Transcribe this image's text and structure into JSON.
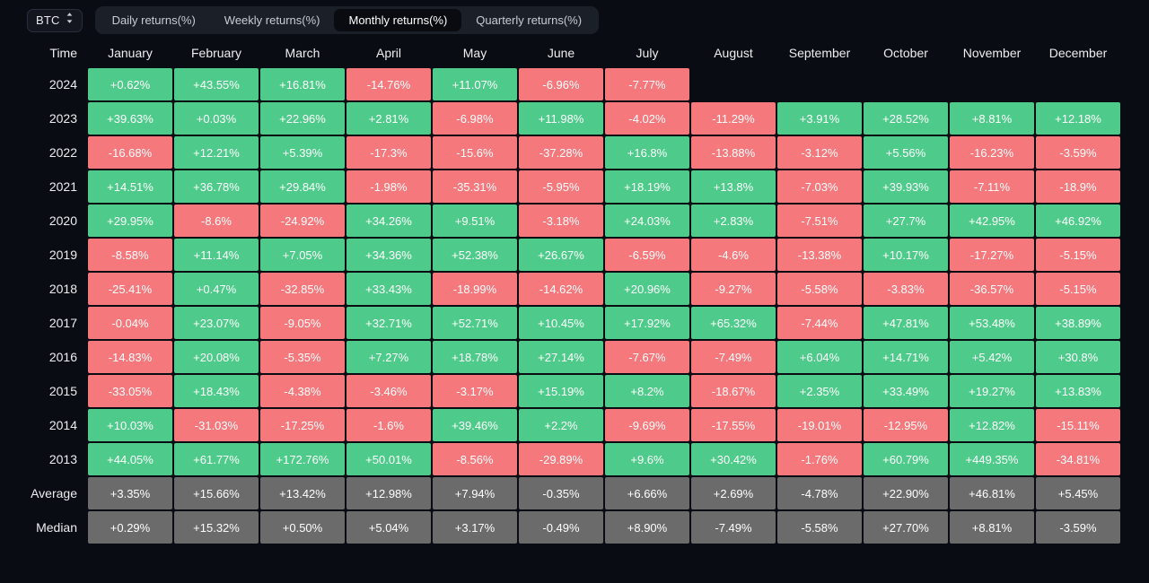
{
  "toolbar": {
    "symbol": "BTC",
    "sort_icon": "chevron-up-down-icon",
    "tabs": [
      {
        "label": "Daily returns(%)",
        "active": false
      },
      {
        "label": "Weekly returns(%)",
        "active": false
      },
      {
        "label": "Monthly returns(%)",
        "active": true
      },
      {
        "label": "Quarterly returns(%)",
        "active": false
      }
    ]
  },
  "colors": {
    "background": "#0a0c13",
    "positive": "#4ecb8a",
    "negative": "#f4787c",
    "summary": "#6b6b6b",
    "tabbar": "#1b1f28",
    "tab_active": "#090b10"
  },
  "chart_data": {
    "type": "heatmap",
    "title": "Monthly returns(%)",
    "xlabel": "",
    "ylabel": "Time",
    "legend_position": "none",
    "grid": false,
    "columns": [
      "Time",
      "January",
      "February",
      "March",
      "April",
      "May",
      "June",
      "July",
      "August",
      "September",
      "October",
      "November",
      "December"
    ],
    "categories": [
      "January",
      "February",
      "March",
      "April",
      "May",
      "June",
      "July",
      "August",
      "September",
      "October",
      "November",
      "December"
    ],
    "rows": [
      {
        "label": "2024",
        "kind": "year",
        "values": [
          "+0.62%",
          "+43.55%",
          "+16.81%",
          "-14.76%",
          "+11.07%",
          "-6.96%",
          "-7.77%",
          "",
          "",
          "",
          "",
          ""
        ]
      },
      {
        "label": "2023",
        "kind": "year",
        "values": [
          "+39.63%",
          "+0.03%",
          "+22.96%",
          "+2.81%",
          "-6.98%",
          "+11.98%",
          "-4.02%",
          "-11.29%",
          "+3.91%",
          "+28.52%",
          "+8.81%",
          "+12.18%"
        ]
      },
      {
        "label": "2022",
        "kind": "year",
        "values": [
          "-16.68%",
          "+12.21%",
          "+5.39%",
          "-17.3%",
          "-15.6%",
          "-37.28%",
          "+16.8%",
          "-13.88%",
          "-3.12%",
          "+5.56%",
          "-16.23%",
          "-3.59%"
        ]
      },
      {
        "label": "2021",
        "kind": "year",
        "values": [
          "+14.51%",
          "+36.78%",
          "+29.84%",
          "-1.98%",
          "-35.31%",
          "-5.95%",
          "+18.19%",
          "+13.8%",
          "-7.03%",
          "+39.93%",
          "-7.11%",
          "-18.9%"
        ]
      },
      {
        "label": "2020",
        "kind": "year",
        "values": [
          "+29.95%",
          "-8.6%",
          "-24.92%",
          "+34.26%",
          "+9.51%",
          "-3.18%",
          "+24.03%",
          "+2.83%",
          "-7.51%",
          "+27.7%",
          "+42.95%",
          "+46.92%"
        ]
      },
      {
        "label": "2019",
        "kind": "year",
        "values": [
          "-8.58%",
          "+11.14%",
          "+7.05%",
          "+34.36%",
          "+52.38%",
          "+26.67%",
          "-6.59%",
          "-4.6%",
          "-13.38%",
          "+10.17%",
          "-17.27%",
          "-5.15%"
        ]
      },
      {
        "label": "2018",
        "kind": "year",
        "values": [
          "-25.41%",
          "+0.47%",
          "-32.85%",
          "+33.43%",
          "-18.99%",
          "-14.62%",
          "+20.96%",
          "-9.27%",
          "-5.58%",
          "-3.83%",
          "-36.57%",
          "-5.15%"
        ]
      },
      {
        "label": "2017",
        "kind": "year",
        "values": [
          "-0.04%",
          "+23.07%",
          "-9.05%",
          "+32.71%",
          "+52.71%",
          "+10.45%",
          "+17.92%",
          "+65.32%",
          "-7.44%",
          "+47.81%",
          "+53.48%",
          "+38.89%"
        ]
      },
      {
        "label": "2016",
        "kind": "year",
        "values": [
          "-14.83%",
          "+20.08%",
          "-5.35%",
          "+7.27%",
          "+18.78%",
          "+27.14%",
          "-7.67%",
          "-7.49%",
          "+6.04%",
          "+14.71%",
          "+5.42%",
          "+30.8%"
        ]
      },
      {
        "label": "2015",
        "kind": "year",
        "values": [
          "-33.05%",
          "+18.43%",
          "-4.38%",
          "-3.46%",
          "-3.17%",
          "+15.19%",
          "+8.2%",
          "-18.67%",
          "+2.35%",
          "+33.49%",
          "+19.27%",
          "+13.83%"
        ]
      },
      {
        "label": "2014",
        "kind": "year",
        "values": [
          "+10.03%",
          "-31.03%",
          "-17.25%",
          "-1.6%",
          "+39.46%",
          "+2.2%",
          "-9.69%",
          "-17.55%",
          "-19.01%",
          "-12.95%",
          "+12.82%",
          "-15.11%"
        ]
      },
      {
        "label": "2013",
        "kind": "year",
        "values": [
          "+44.05%",
          "+61.77%",
          "+172.76%",
          "+50.01%",
          "-8.56%",
          "-29.89%",
          "+9.6%",
          "+30.42%",
          "-1.76%",
          "+60.79%",
          "+449.35%",
          "-34.81%"
        ]
      },
      {
        "label": "Average",
        "kind": "summary",
        "values": [
          "+3.35%",
          "+15.66%",
          "+13.42%",
          "+12.98%",
          "+7.94%",
          "-0.35%",
          "+6.66%",
          "+2.69%",
          "-4.78%",
          "+22.90%",
          "+46.81%",
          "+5.45%"
        ]
      },
      {
        "label": "Median",
        "kind": "summary",
        "values": [
          "+0.29%",
          "+15.32%",
          "+0.50%",
          "+5.04%",
          "+3.17%",
          "-0.49%",
          "+8.90%",
          "-7.49%",
          "-5.58%",
          "+27.70%",
          "+8.81%",
          "-3.59%"
        ]
      }
    ]
  }
}
